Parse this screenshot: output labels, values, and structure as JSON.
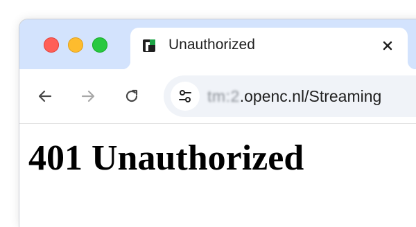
{
  "window": {
    "controls": [
      "close",
      "minimize",
      "zoom"
    ]
  },
  "tab": {
    "title": "Unauthorized",
    "favicon_icon": "f-logo-icon",
    "close_icon": "close-icon"
  },
  "toolbar": {
    "back_icon": "arrow-left-icon",
    "forward_icon": "arrow-right-icon",
    "reload_icon": "reload-icon",
    "site_info_icon": "tune-icon"
  },
  "address_bar": {
    "url_obscured": "tm:2",
    "url_visible": ".openc.nl/Streaming"
  },
  "page": {
    "heading": "401 Unauthorized"
  },
  "colors": {
    "tabstrip": "#d3e3fd",
    "omnibox": "#f0f3f8",
    "close_light": "#ff5f57",
    "minimize_light": "#febc2e",
    "zoom_light": "#28c840",
    "favicon_accent": "#1ea446"
  }
}
